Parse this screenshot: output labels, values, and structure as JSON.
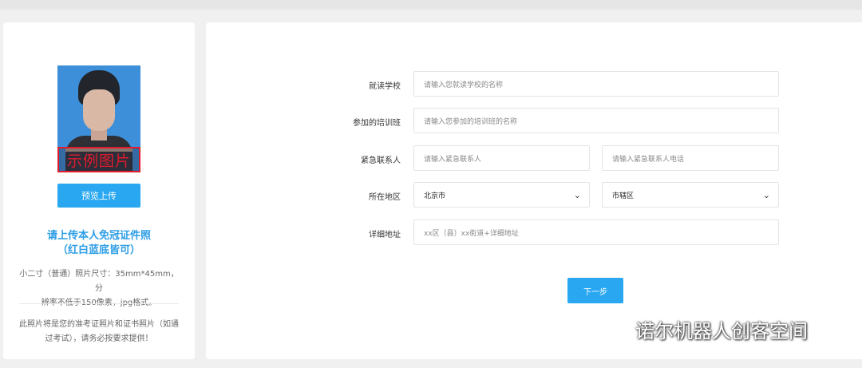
{
  "left": {
    "photo_caption": "示例图片",
    "preview_button": "预览上传",
    "upload_title_line1": "请上传本人免冠证件照",
    "upload_title_line2": "（红白蓝底皆可）",
    "spec_line1": "小二寸（普通）照片尺寸：35mm*45mm，分",
    "spec_line2": "辨率不低于150像素，jpg格式。",
    "note_line1": "此照片将是您的准考证照片和证书照片（如通",
    "note_line2": "过考试），请务必按要求提供！"
  },
  "form": {
    "school_label": "就读学校",
    "school_placeholder": "请输入您就读学校的名称",
    "class_label": "参加的培训班",
    "class_placeholder": "请输入您参加的培训班的名称",
    "contact_label": "紧急联系人",
    "contact_name_placeholder": "请输入紧急联系人",
    "contact_phone_placeholder": "请输入紧急联系人电话",
    "region_label": "所在地区",
    "region_city": "北京市",
    "region_district": "市辖区",
    "address_label": "详细地址",
    "address_placeholder": "xx区（县）xx街道+详细地址",
    "next_button": "下一步"
  },
  "watermark": {
    "text": "诺尔机器人创客空间",
    "icon": "wechat-icon"
  },
  "colors": {
    "accent": "#29a7f0",
    "title_blue": "#2e9ee6",
    "caption_red": "#e01b2c"
  }
}
